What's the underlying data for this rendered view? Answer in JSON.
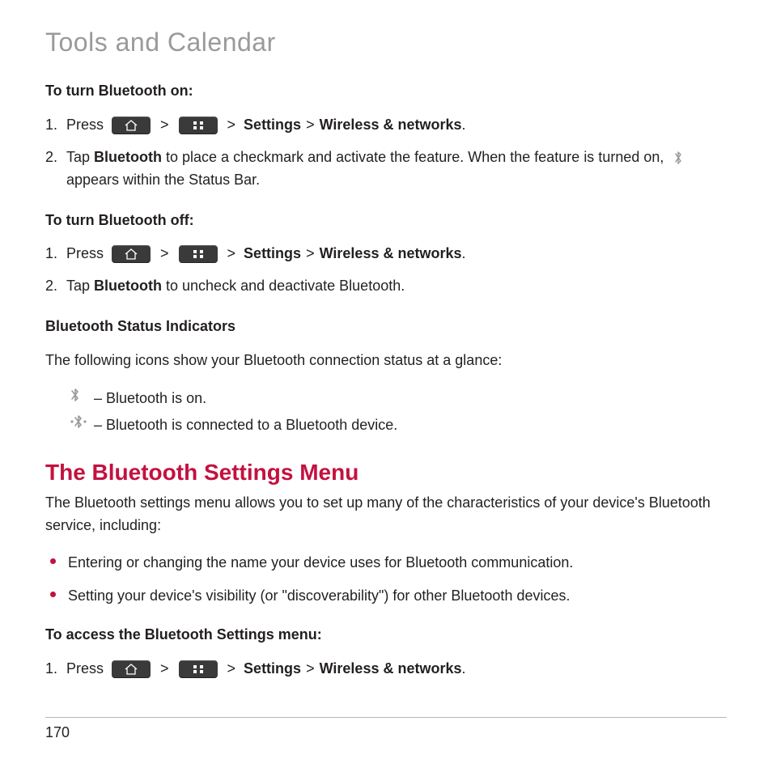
{
  "title": "Tools and Calendar",
  "pageNumber": "170",
  "generic": {
    "pressLabel": "Press",
    "sep": ">",
    "settings": "Settings",
    "wireless": "Wireless & networks",
    "period": "."
  },
  "block1": {
    "heading": "To turn Bluetooth on:",
    "step1num": "1.",
    "step2num": "2.",
    "step2_a": "Tap ",
    "step2_bold": "Bluetooth",
    "step2_b": " to place a checkmark and activate the feature. When the feature is turned on, ",
    "step2_c": "appears within the Status Bar."
  },
  "block2": {
    "heading": "To turn Bluetooth off:",
    "step1num": "1.",
    "step2num": "2.",
    "step2_a": "Tap ",
    "step2_bold": "Bluetooth",
    "step2_b": " to uncheck and deactivate Bluetooth."
  },
  "block3": {
    "heading": "Bluetooth Status Indicators",
    "intro": "The following icons show your Bluetooth connection status at a glance:",
    "item1": "– Bluetooth is on.",
    "item2": "– Bluetooth is connected to a Bluetooth device."
  },
  "block4": {
    "heading": "The Bluetooth Settings Menu",
    "intro": "The Bluetooth settings menu allows you to set up many of the characteristics of your device's Bluetooth service, including:",
    "bullet1": "Entering or changing the name your device uses for Bluetooth communication.",
    "bullet2": "Setting your device's visibility (or \"discoverability\") for other Bluetooth devices.",
    "sub": "To access the Bluetooth Settings menu:",
    "step1num": "1."
  }
}
